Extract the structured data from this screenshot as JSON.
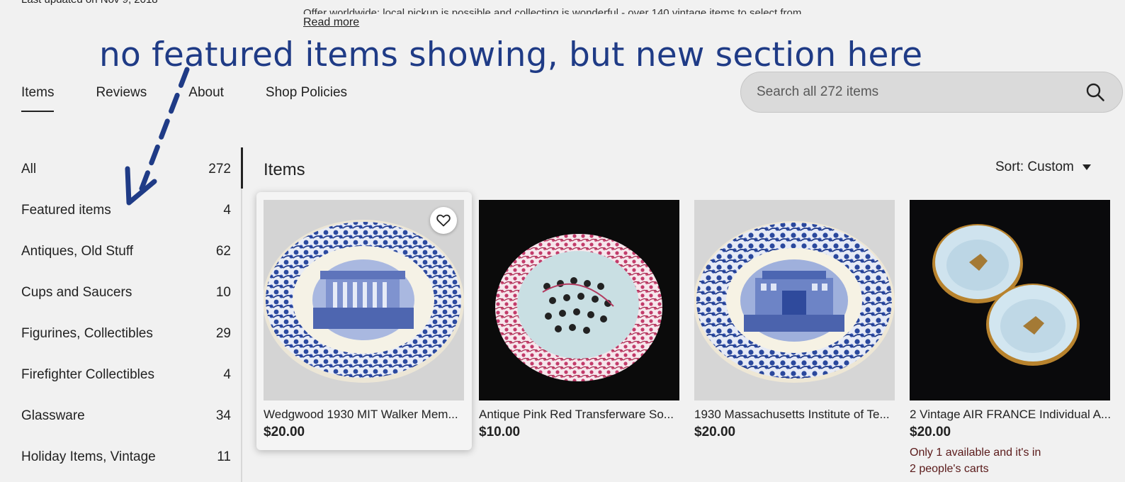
{
  "page": {
    "clipped_updated": "Last updated on Nov 9, 2018",
    "clipped_about": "Offer worldwide; local pickup is possible and collecting is wonderful - over 140 vintage items to select from.",
    "read_more": "Read more"
  },
  "annotation": {
    "text": "no featured items showing, but new section here",
    "color": "#1f3b86"
  },
  "tabs": [
    {
      "label": "Items",
      "active": true
    },
    {
      "label": "Reviews",
      "active": false
    },
    {
      "label": "About",
      "active": false
    },
    {
      "label": "Shop Policies",
      "active": false
    }
  ],
  "search": {
    "placeholder": "Search all 272 items",
    "icon": "search-icon"
  },
  "sidebar": {
    "items": [
      {
        "label": "All",
        "count": "272",
        "active": true
      },
      {
        "label": "Featured items",
        "count": "4"
      },
      {
        "label": "Antiques, Old Stuff",
        "count": "62"
      },
      {
        "label": "Cups and Saucers",
        "count": "10"
      },
      {
        "label": "Figurines, Collectibles",
        "count": "29"
      },
      {
        "label": "Firefighter Collectibles",
        "count": "4"
      },
      {
        "label": "Glassware",
        "count": "34"
      },
      {
        "label": "Holiday Items, Vintage",
        "count": "11"
      }
    ]
  },
  "main": {
    "heading": "Items",
    "sort_label": "Sort: Custom"
  },
  "listings": [
    {
      "title": "Wedgwood 1930 MIT Walker Mem...",
      "price": "$20.00",
      "image": "blue-transferware-plate-building",
      "hovered": true
    },
    {
      "title": "Antique Pink Red Transferware So...",
      "price": "$10.00",
      "image": "pink-transferware-soap-dish"
    },
    {
      "title": "1930 Massachusetts Institute of Te...",
      "price": "$20.00",
      "image": "blue-transferware-plate-mit"
    },
    {
      "title": "2 Vintage AIR FRANCE Individual A...",
      "price": "$20.00",
      "image": "air-france-ashtrays",
      "note_line1": "Only 1 available and it's in",
      "note_line2": "2 people's carts"
    }
  ]
}
